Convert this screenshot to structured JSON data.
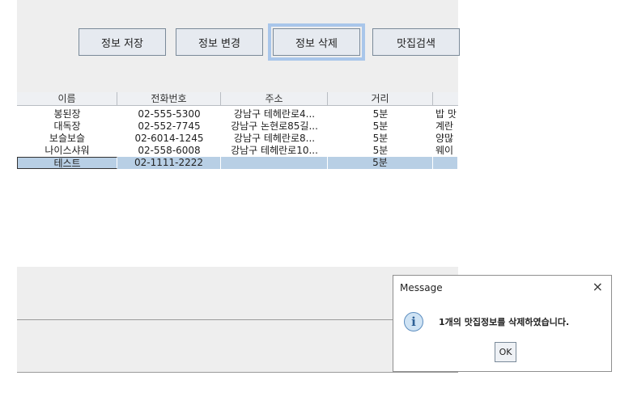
{
  "toolbar": {
    "save_label": "정보 저장",
    "edit_label": "정보 변경",
    "delete_label": "정보 삭제",
    "search_label": "맛집검색"
  },
  "table": {
    "columns": [
      "이름",
      "전화번호",
      "주소",
      "거리",
      ""
    ],
    "rows": [
      {
        "name": "봉된장",
        "phone": "02-555-5300",
        "address": "강남구 테헤란로4...",
        "distance": "5분",
        "extra": "밥 맛"
      },
      {
        "name": "대독장",
        "phone": "02-552-7745",
        "address": "강남구 논현로85길...",
        "distance": "5분",
        "extra": "계란"
      },
      {
        "name": "보슬보슬",
        "phone": "02-6014-1245",
        "address": "강남구 테헤란로8...",
        "distance": "5분",
        "extra": "양많"
      },
      {
        "name": "나이스샤워",
        "phone": "02-558-6008",
        "address": "강남구 테헤란로10...",
        "distance": "5분",
        "extra": "웨이"
      },
      {
        "name": "테스트",
        "phone": "02-1111-2222",
        "address": "",
        "distance": "5분",
        "extra": ""
      }
    ]
  },
  "dialog": {
    "title": "Message",
    "close": "×",
    "icon": "i",
    "message": "1개의 맛집정보를 삭제하였습니다.",
    "ok_label": "OK"
  }
}
